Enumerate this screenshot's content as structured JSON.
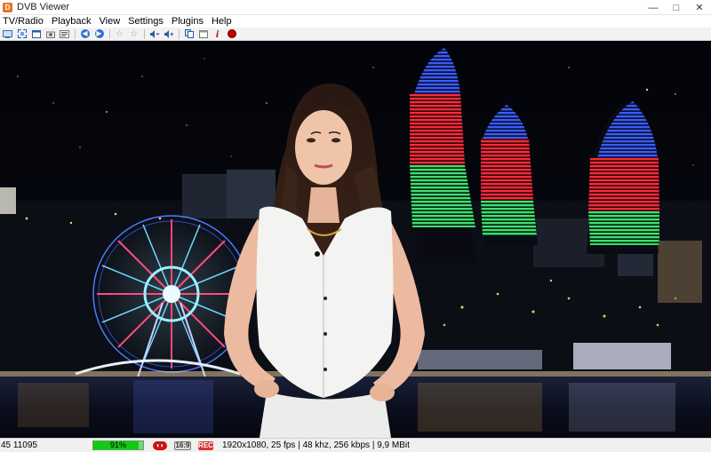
{
  "window": {
    "title": "DVB Viewer",
    "minimize": "—",
    "maximize": "□",
    "close": "✕"
  },
  "menu": [
    "TV/Radio",
    "Playback",
    "View",
    "Settings",
    "Plugins",
    "Help"
  ],
  "toolbar_icons": [
    "tv-icon",
    "fullscreen-icon",
    "window-mode-icon",
    "screenshot-icon",
    "teletext-icon",
    "back-icon",
    "forward-icon",
    "favorite-icon",
    "favorite-add-icon",
    "volume-down-icon",
    "volume-up-icon",
    "copy-icon",
    "epg-icon",
    "info-icon",
    "record-icon"
  ],
  "status": {
    "channel": "45 11095",
    "signal_text": "91%",
    "signal_level": 91,
    "badge_16_9": "16:9",
    "badge_rec": "REC",
    "stream_info": "1920x1080, 25 fps | 48 khz, 256 kbps | 9,9 MBit"
  },
  "colors": {
    "flame_blue": "#2f56ff",
    "flame_red": "#ff2637",
    "flame_green": "#34d86a",
    "signal_green": "#13c913",
    "record_red": "#c00000"
  }
}
